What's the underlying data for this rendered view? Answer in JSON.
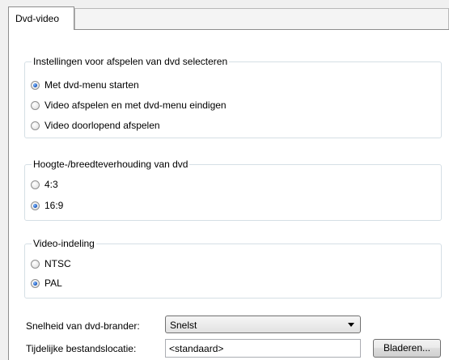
{
  "tabs": [
    {
      "label": "Dvd-video",
      "active": true
    }
  ],
  "playback_group": {
    "title": "Instellingen voor afspelen van dvd selecteren",
    "options": [
      {
        "label": "Met dvd-menu starten",
        "checked": true
      },
      {
        "label": "Video afspelen en met dvd-menu eindigen",
        "checked": false
      },
      {
        "label": "Video doorlopend afspelen",
        "checked": false
      }
    ]
  },
  "aspect_group": {
    "title": "Hoogte-/breedteverhouding van dvd",
    "options": [
      {
        "label": "4:3",
        "checked": false
      },
      {
        "label": "16:9",
        "checked": true
      }
    ]
  },
  "format_group": {
    "title": "Video-indeling",
    "options": [
      {
        "label": "NTSC",
        "checked": false
      },
      {
        "label": "PAL",
        "checked": true
      }
    ]
  },
  "burner_speed": {
    "label": "Snelheid van dvd-brander:",
    "value": "Snelst"
  },
  "temp_location": {
    "label": "Tijdelijke bestandslocatie:",
    "value": "<standaard>"
  },
  "browse_button": {
    "label": "Bladeren..."
  }
}
